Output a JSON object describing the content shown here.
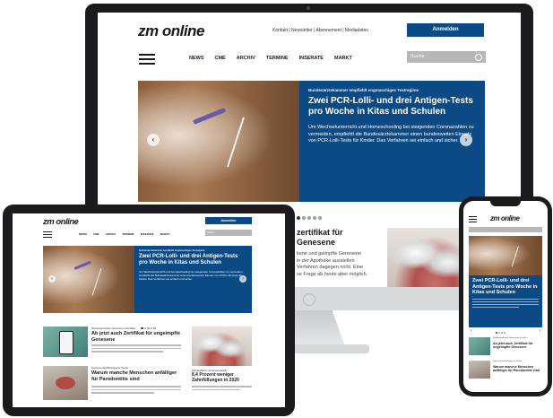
{
  "desktop": {
    "logo": "zm online",
    "topnav": [
      "Kontakt",
      "Newsletter",
      "Abonnement",
      "Mediadaten"
    ],
    "login_label": "Anmelden",
    "nav": [
      "NEWS",
      "CME",
      "ARCHIV",
      "TERMINE",
      "INSERATE",
      "MARKT"
    ],
    "search_placeholder": "Suche",
    "hero": {
      "kicker": "Bundesärztekammer empfiehlt engmaschiges Testregime",
      "title": "Zwei PCR-Lolli- und drei Antigen-Tests pro Woche in Kitas und Schulen",
      "body": "Um Wechselunterricht und Homeschooling bei steigenden Coronazahlen zu vermeiden, empfiehlt die Bundesärztekammer einen bundesweiten Einsatz von PCR-Lolli-Tests für Kinder. Das Verfahren sei einfach und sicher."
    },
    "second": {
      "title_partial": [
        "zertifikat für",
        "Genesene"
      ],
      "body_partial": [
        "kene und geimpfte Genesene",
        "in der Apotheke ausstellen",
        "Verfahren dagegen nicht. Eine",
        "se Frage ab heute aber möglich."
      ]
    }
  },
  "tablet": {
    "logo": "zm online",
    "login_label": "Anmelden",
    "search_placeholder": "Suche",
    "nav": [
      "NEWS",
      "CME",
      "ARCHIV",
      "TERMINE",
      "INSERATE",
      "MARKT"
    ],
    "hero_kicker": "Bundesärztekammer empfiehlt engmaschiges Testregime",
    "hero_title": "Zwei PCR-Lolli- und drei Antigen-Tests pro Woche in Kitas und Schulen",
    "hero_body": "Um Wechselunterricht und Homeschooling bei steigenden Coronazahlen zu vermeiden, empfiehlt die Bundesärztekammer einen bundesweiten Einsatz von PCR-Lolli-Tests für Kinder. Das Verfahren sei einfach und sicher.",
    "teasers": [
      {
        "kicker": "Bundesapotheker-Genesenen-Zertifikat",
        "title": "Ab jetzt auch Zertifikat für ungeimpfte Genesene"
      },
      {
        "kicker": "Experimentell-Biologische Studie",
        "title": "Warum manche Menschen anfälliger für Parodontitis sind"
      }
    ],
    "side_teaser": {
      "kicker": "Zahnärztliche Leistungsstatistik",
      "title": "8,4 Prozent weniger Zahnfüllungen in 2020"
    }
  },
  "phone": {
    "logo": "zm online",
    "hero_title": "Zwei PCR-Lolli- und drei Antigen-Tests pro Woche in Kitas und Schulen",
    "teasers": [
      {
        "kicker": "Bundesapotheker-Genesenen-Zertifikat",
        "title": "Ab jetzt auch Zertifikat für ungeimpfte Genesene"
      },
      {
        "kicker": "Experimentell-Biologische Studie",
        "title": "Warum manche Menschen anfälliger für Parodontitis sind"
      }
    ]
  }
}
